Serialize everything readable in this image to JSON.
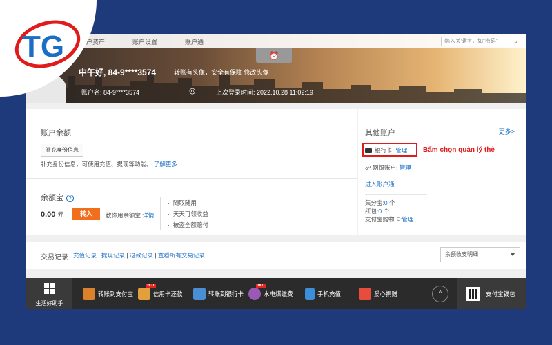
{
  "colors": {
    "accent": "#1a6ec4",
    "primary_button": "#f06e1c",
    "annotation": "#e01b1b",
    "page_bg": "#1e3a7a"
  },
  "logo": {
    "text": "TG"
  },
  "topnav": {
    "items": [
      "账户资产",
      "账户设置",
      "账户通"
    ],
    "search_placeholder": "输入关键字，如\"密码\""
  },
  "header": {
    "greeting": "中午好, 84-9****3574",
    "greeting_links": "转账有头像，安全有保障 修改头像",
    "account_label": "账户名:",
    "account_value": "84-9****3574",
    "last_login": "上次登录时间: 2022.10.28 11:02:19"
  },
  "balance": {
    "title": "账户余额",
    "id_button": "补充身份信息",
    "note": "补充身份信息，可使用充值、提现等功能。",
    "note_link": "了解更多"
  },
  "yuebao": {
    "title": "余额宝",
    "help": "?",
    "amount": "0.00",
    "unit": "元",
    "transfer_button": "转入",
    "note": "教你用余额宝",
    "note_link": "详情",
    "features": [
      "随取随用",
      "天天可领收益",
      "被盗全额赔付"
    ]
  },
  "other_accounts": {
    "title": "其他账户",
    "more": "更多>",
    "bank_label": "银行卡:",
    "bank_link": "管理",
    "annotation": "Bấm chọn quản lý thẻ",
    "net_label": "网银账户:",
    "net_link": "管理",
    "enter_link": "进入账户通",
    "jifenbao": "集分宝:",
    "jifenbao_value": "0",
    "jifenbao_unit": "个",
    "hongbao": "红包:",
    "hongbao_value": "0",
    "hongbao_unit": "个",
    "giftcard": "支付宝购物卡:",
    "giftcard_link": "管理"
  },
  "transactions": {
    "title": "交易记录",
    "links": [
      "充值记录",
      "提现记录",
      "退款记录",
      "查看所有交易记录"
    ],
    "select": "余额收支明细"
  },
  "bottombar": {
    "life_helper": "生活好助手",
    "tools": [
      {
        "label": "转账到支付宝",
        "icon": "envelope-icon",
        "color": "#d9822b"
      },
      {
        "label": "信用卡还款",
        "icon": "credit-card-icon",
        "color": "#e2a03c",
        "hot": "HOT"
      },
      {
        "label": "转账到银行卡",
        "icon": "bank-card-icon",
        "color": "#4a8fd6"
      },
      {
        "label": "水电煤缴费",
        "icon": "utility-icon",
        "color": "#9b59b6",
        "hot": "HOT"
      },
      {
        "label": "手机充值",
        "icon": "phone-icon",
        "color": "#3b8fd9"
      },
      {
        "label": "爱心捐赠",
        "icon": "heart-icon",
        "color": "#e74c3c"
      }
    ],
    "up": "^",
    "wallet": "支付宝钱包"
  }
}
